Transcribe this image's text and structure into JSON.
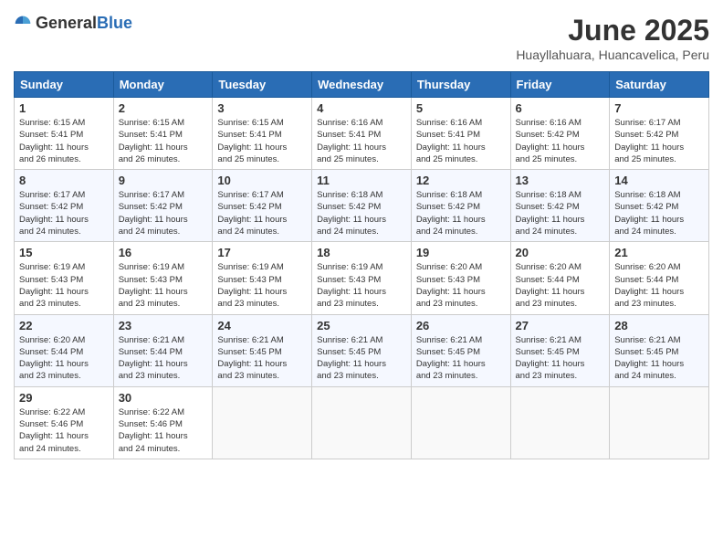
{
  "header": {
    "logo_general": "General",
    "logo_blue": "Blue",
    "month": "June 2025",
    "location": "Huayllahuara, Huancavelica, Peru"
  },
  "days_of_week": [
    "Sunday",
    "Monday",
    "Tuesday",
    "Wednesday",
    "Thursday",
    "Friday",
    "Saturday"
  ],
  "weeks": [
    [
      {
        "day": "1",
        "info": "Sunrise: 6:15 AM\nSunset: 5:41 PM\nDaylight: 11 hours\nand 26 minutes."
      },
      {
        "day": "2",
        "info": "Sunrise: 6:15 AM\nSunset: 5:41 PM\nDaylight: 11 hours\nand 26 minutes."
      },
      {
        "day": "3",
        "info": "Sunrise: 6:15 AM\nSunset: 5:41 PM\nDaylight: 11 hours\nand 25 minutes."
      },
      {
        "day": "4",
        "info": "Sunrise: 6:16 AM\nSunset: 5:41 PM\nDaylight: 11 hours\nand 25 minutes."
      },
      {
        "day": "5",
        "info": "Sunrise: 6:16 AM\nSunset: 5:41 PM\nDaylight: 11 hours\nand 25 minutes."
      },
      {
        "day": "6",
        "info": "Sunrise: 6:16 AM\nSunset: 5:42 PM\nDaylight: 11 hours\nand 25 minutes."
      },
      {
        "day": "7",
        "info": "Sunrise: 6:17 AM\nSunset: 5:42 PM\nDaylight: 11 hours\nand 25 minutes."
      }
    ],
    [
      {
        "day": "8",
        "info": "Sunrise: 6:17 AM\nSunset: 5:42 PM\nDaylight: 11 hours\nand 24 minutes."
      },
      {
        "day": "9",
        "info": "Sunrise: 6:17 AM\nSunset: 5:42 PM\nDaylight: 11 hours\nand 24 minutes."
      },
      {
        "day": "10",
        "info": "Sunrise: 6:17 AM\nSunset: 5:42 PM\nDaylight: 11 hours\nand 24 minutes."
      },
      {
        "day": "11",
        "info": "Sunrise: 6:18 AM\nSunset: 5:42 PM\nDaylight: 11 hours\nand 24 minutes."
      },
      {
        "day": "12",
        "info": "Sunrise: 6:18 AM\nSunset: 5:42 PM\nDaylight: 11 hours\nand 24 minutes."
      },
      {
        "day": "13",
        "info": "Sunrise: 6:18 AM\nSunset: 5:42 PM\nDaylight: 11 hours\nand 24 minutes."
      },
      {
        "day": "14",
        "info": "Sunrise: 6:18 AM\nSunset: 5:42 PM\nDaylight: 11 hours\nand 24 minutes."
      }
    ],
    [
      {
        "day": "15",
        "info": "Sunrise: 6:19 AM\nSunset: 5:43 PM\nDaylight: 11 hours\nand 23 minutes."
      },
      {
        "day": "16",
        "info": "Sunrise: 6:19 AM\nSunset: 5:43 PM\nDaylight: 11 hours\nand 23 minutes."
      },
      {
        "day": "17",
        "info": "Sunrise: 6:19 AM\nSunset: 5:43 PM\nDaylight: 11 hours\nand 23 minutes."
      },
      {
        "day": "18",
        "info": "Sunrise: 6:19 AM\nSunset: 5:43 PM\nDaylight: 11 hours\nand 23 minutes."
      },
      {
        "day": "19",
        "info": "Sunrise: 6:20 AM\nSunset: 5:43 PM\nDaylight: 11 hours\nand 23 minutes."
      },
      {
        "day": "20",
        "info": "Sunrise: 6:20 AM\nSunset: 5:44 PM\nDaylight: 11 hours\nand 23 minutes."
      },
      {
        "day": "21",
        "info": "Sunrise: 6:20 AM\nSunset: 5:44 PM\nDaylight: 11 hours\nand 23 minutes."
      }
    ],
    [
      {
        "day": "22",
        "info": "Sunrise: 6:20 AM\nSunset: 5:44 PM\nDaylight: 11 hours\nand 23 minutes."
      },
      {
        "day": "23",
        "info": "Sunrise: 6:21 AM\nSunset: 5:44 PM\nDaylight: 11 hours\nand 23 minutes."
      },
      {
        "day": "24",
        "info": "Sunrise: 6:21 AM\nSunset: 5:45 PM\nDaylight: 11 hours\nand 23 minutes."
      },
      {
        "day": "25",
        "info": "Sunrise: 6:21 AM\nSunset: 5:45 PM\nDaylight: 11 hours\nand 23 minutes."
      },
      {
        "day": "26",
        "info": "Sunrise: 6:21 AM\nSunset: 5:45 PM\nDaylight: 11 hours\nand 23 minutes."
      },
      {
        "day": "27",
        "info": "Sunrise: 6:21 AM\nSunset: 5:45 PM\nDaylight: 11 hours\nand 23 minutes."
      },
      {
        "day": "28",
        "info": "Sunrise: 6:21 AM\nSunset: 5:45 PM\nDaylight: 11 hours\nand 24 minutes."
      }
    ],
    [
      {
        "day": "29",
        "info": "Sunrise: 6:22 AM\nSunset: 5:46 PM\nDaylight: 11 hours\nand 24 minutes."
      },
      {
        "day": "30",
        "info": "Sunrise: 6:22 AM\nSunset: 5:46 PM\nDaylight: 11 hours\nand 24 minutes."
      },
      {
        "day": "",
        "info": ""
      },
      {
        "day": "",
        "info": ""
      },
      {
        "day": "",
        "info": ""
      },
      {
        "day": "",
        "info": ""
      },
      {
        "day": "",
        "info": ""
      }
    ]
  ]
}
